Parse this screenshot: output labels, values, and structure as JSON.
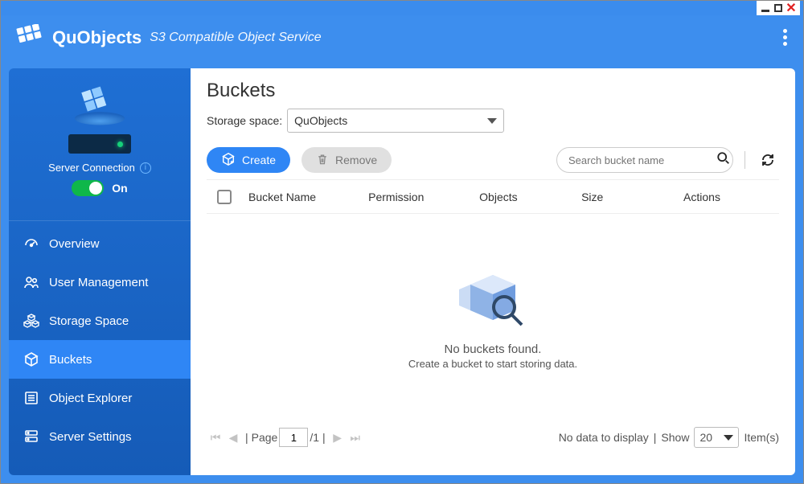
{
  "app": {
    "title": "QuObjects",
    "subtitle": "S3 Compatible Object Service"
  },
  "sidebar": {
    "connection_label": "Server Connection",
    "toggle_label": "On",
    "items": [
      {
        "label": "Overview"
      },
      {
        "label": "User Management"
      },
      {
        "label": "Storage Space"
      },
      {
        "label": "Buckets"
      },
      {
        "label": "Object Explorer"
      },
      {
        "label": "Server Settings"
      }
    ]
  },
  "main": {
    "title": "Buckets",
    "storage_label": "Storage space:",
    "storage_value": "QuObjects",
    "create_label": "Create",
    "remove_label": "Remove",
    "search_placeholder": "Search bucket name",
    "columns": {
      "bucket": "Bucket Name",
      "permission": "Permission",
      "objects": "Objects",
      "size": "Size",
      "actions": "Actions"
    },
    "empty_primary": "No buckets found.",
    "empty_secondary": "Create a bucket to start storing data."
  },
  "pager": {
    "page_label": "Page",
    "page_value": "1",
    "page_total": "/1",
    "no_data": "No data to display",
    "show_label": "Show",
    "show_value": "20",
    "items_label": "Item(s)"
  }
}
